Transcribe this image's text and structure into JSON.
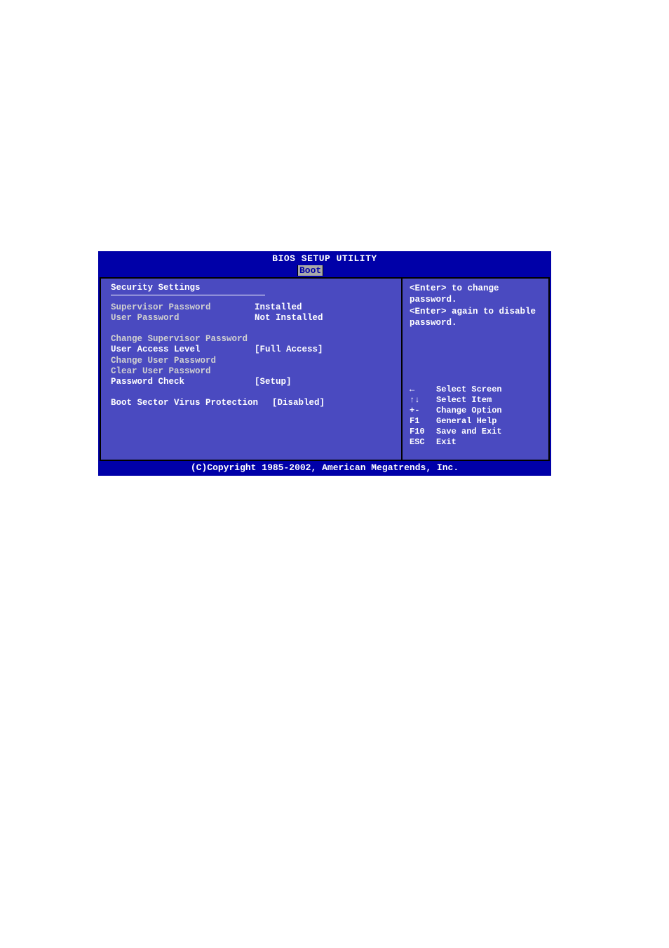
{
  "title": "BIOS SETUP UTILITY",
  "tab": "Boot",
  "section_title": "Security Settings",
  "rows": {
    "supervisor_pw": {
      "label": "Supervisor Password",
      "value": "Installed"
    },
    "user_pw": {
      "label": "User Password",
      "value": "Not Installed"
    },
    "change_supervisor": {
      "label": "Change Supervisor Password"
    },
    "user_access": {
      "label": "User Access Level",
      "value": "[Full Access]"
    },
    "change_user": {
      "label": "Change User Password"
    },
    "clear_user": {
      "label": "Clear User Password"
    },
    "password_check": {
      "label": "Password Check",
      "value": "[Setup]"
    },
    "boot_sector": {
      "label": "Boot Sector Virus Protection",
      "value": "[Disabled]"
    }
  },
  "help": {
    "line1": "<Enter> to change password.",
    "line2": "<Enter> again to disable password."
  },
  "nav": {
    "select_screen": "Select Screen",
    "select_item": "Select Item",
    "plusminus_key": "+-",
    "plusminus": "Change Option",
    "f1_key": "F1",
    "f1": "General Help",
    "f10_key": "F10",
    "f10": "Save and Exit",
    "esc_key": "ESC",
    "esc": "Exit"
  },
  "footer": "(C)Copyright 1985-2002, American Megatrends, Inc."
}
